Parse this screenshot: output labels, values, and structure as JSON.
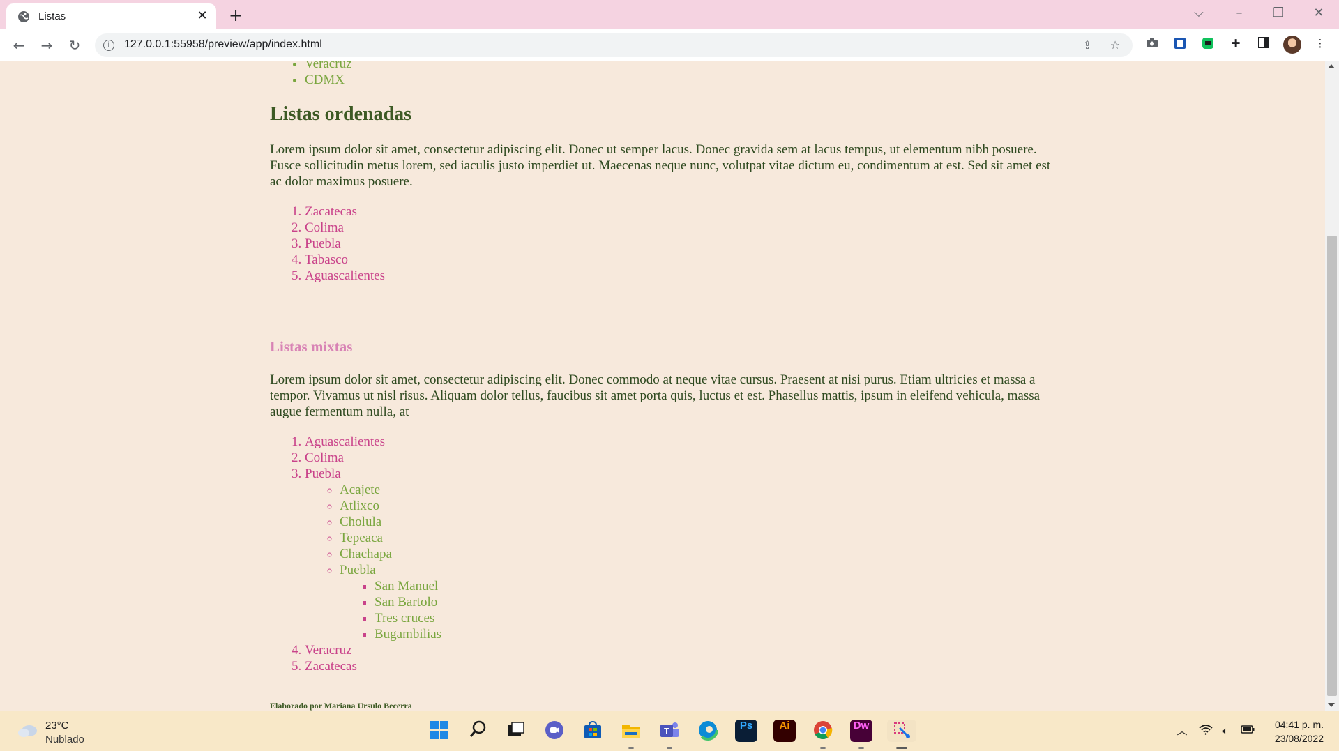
{
  "browser": {
    "tab_title": "Listas",
    "url": "127.0.0.1:55958/preview/app/index.html"
  },
  "page": {
    "top_list": [
      "Veracruz",
      "CDMX"
    ],
    "ordered_section": {
      "heading": "Listas ordenadas",
      "paragraph": "Lorem ipsum dolor sit amet, consectetur adipiscing elit. Donec ut semper lacus. Donec gravida sem at lacus tempus, ut elementum nibh posuere. Fusce sollicitudin metus lorem, sed iaculis justo imperdiet ut. Maecenas neque nunc, volutpat vitae dictum eu, condimentum at est. Sed sit amet est ac dolor maximus posuere.",
      "items": [
        "Zacatecas",
        "Colima",
        "Puebla",
        "Tabasco",
        "Aguascalientes"
      ]
    },
    "mixed_section": {
      "heading": "Listas mixtas",
      "paragraph": "Lorem ipsum dolor sit amet, consectetur adipiscing elit. Donec commodo at neque vitae cursus. Praesent at nisi purus. Etiam ultricies et massa a tempor. Vivamus ut nisl risus. Aliquam dolor tellus, faucibus sit amet porta quis, luctus et est. Phasellus mattis, ipsum in eleifend vehicula, massa augue fermentum nulla, at",
      "items": [
        "Aguascalientes",
        "Colima",
        "Puebla",
        "Veracruz",
        "Zacatecas"
      ],
      "puebla_sub": [
        "Acajete",
        "Atlixco",
        "Cholula",
        "Tepeaca",
        "Chachapa",
        "Puebla"
      ],
      "puebla_sub_sub": [
        "San Manuel",
        "San Bartolo",
        "Tres cruces",
        "Bugambilias"
      ]
    },
    "footer": "Elaborado por Mariana Ursulo Becerra"
  },
  "taskbar": {
    "weather_temp": "23°C",
    "weather_desc": "Nublado",
    "time": "04:41 p. m.",
    "date": "23/08/2022"
  },
  "colors": {
    "page_bg": "#f7e9dc",
    "green_list": "#7aa63f",
    "pink_list": "#c9428a",
    "heading_green": "#3d5a24",
    "heading_pink": "#d883b5",
    "tabstrip": "#f5d3e1",
    "taskbar": "#f8e8c8"
  }
}
